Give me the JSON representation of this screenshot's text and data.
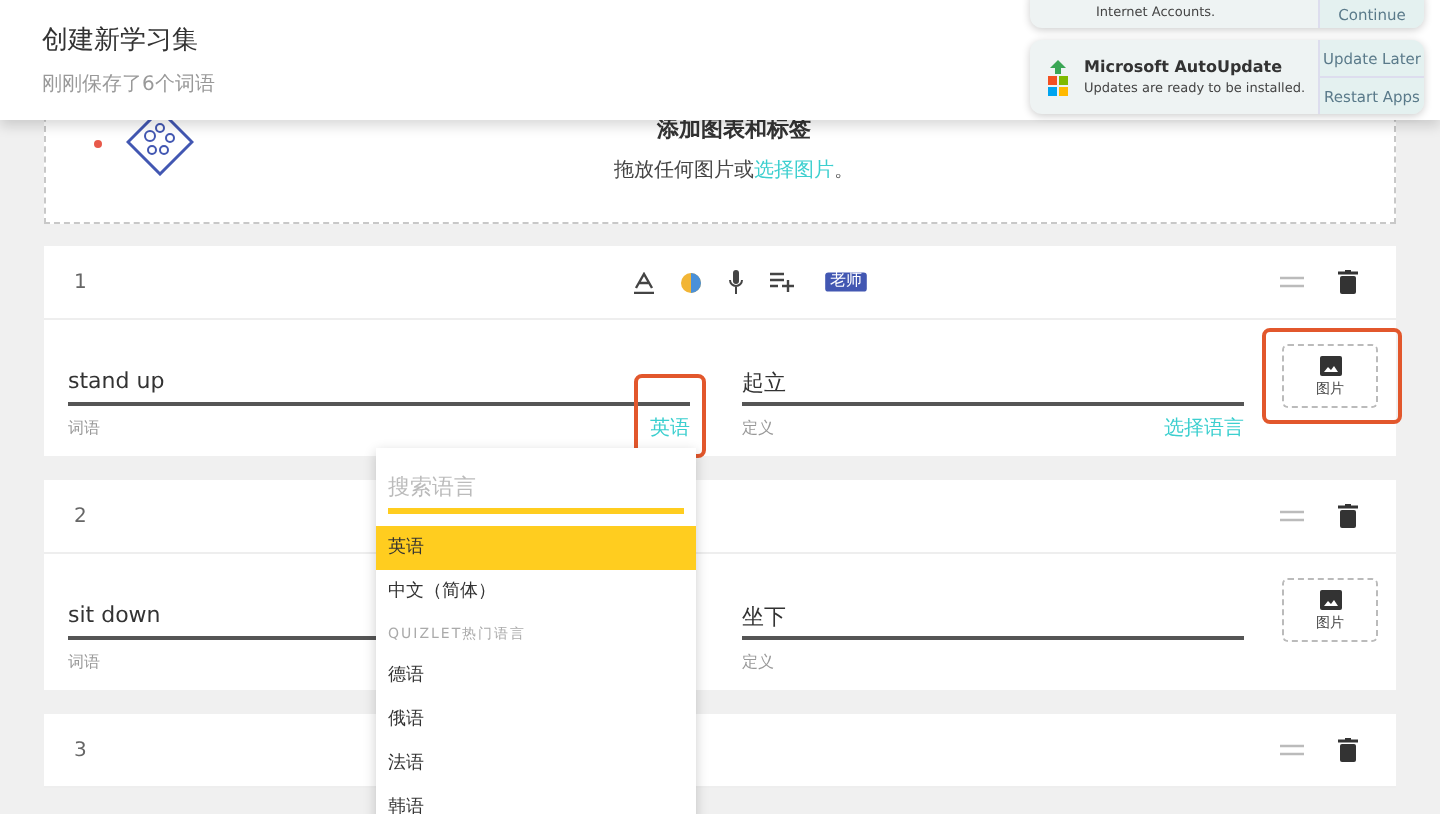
{
  "header": {
    "title": "创建新学习集",
    "subtitle": "刚刚保存了6个词语"
  },
  "notifications": [
    {
      "body": "Internet Accounts.",
      "actions": [
        "Continue"
      ]
    },
    {
      "title": "Microsoft AutoUpdate",
      "body": "Updates are ready to be installed.",
      "actions": [
        "Update Later",
        "Restart Apps"
      ]
    }
  ],
  "image_drop": {
    "title": "添加图表和标签",
    "text": "拖放任何图片或",
    "link": "选择图片",
    "text_after": "。"
  },
  "cards": [
    {
      "number": "1",
      "active": true,
      "badge": "老师",
      "term": "stand up",
      "term_label": "词语",
      "term_language": "英语",
      "term_language_highlighted": true,
      "definition": "起立",
      "definition_label": "定义",
      "definition_language": "选择语言",
      "image_label": "图片",
      "image_highlighted": true
    },
    {
      "number": "2",
      "active": false,
      "term": "sit down",
      "term_label": "词语",
      "term_language_highlighted": false,
      "definition": "坐下",
      "definition_label": "定义",
      "image_label": "图片",
      "image_highlighted": false
    },
    {
      "number": "3",
      "active": false
    }
  ],
  "language_menu": {
    "placeholder": "搜索语言",
    "items": [
      {
        "kind": "option",
        "label": "英语",
        "selected": true
      },
      {
        "kind": "option",
        "label": "中文（简体）",
        "selected": false
      },
      {
        "kind": "heading",
        "label": "QUIZLET热门语言"
      },
      {
        "kind": "option",
        "label": "德语",
        "selected": false
      },
      {
        "kind": "option",
        "label": "俄语",
        "selected": false
      },
      {
        "kind": "option",
        "label": "法语",
        "selected": false
      },
      {
        "kind": "option",
        "label": "韩语",
        "selected": false
      }
    ]
  }
}
